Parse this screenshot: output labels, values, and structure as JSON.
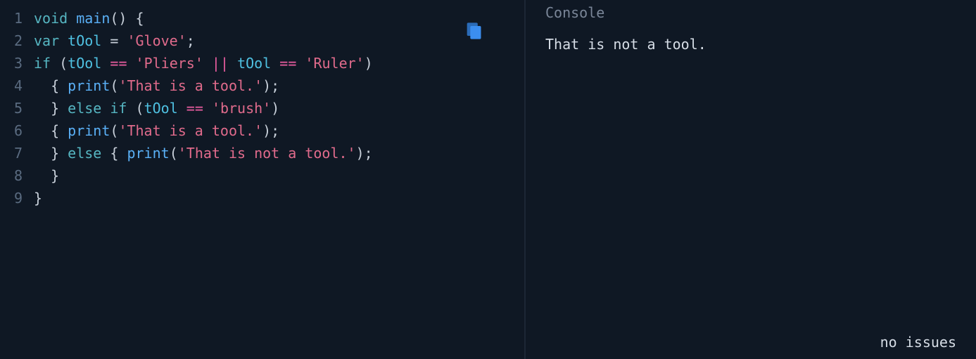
{
  "editor": {
    "line_numbers": [
      "1",
      "2",
      "3",
      "4",
      "5",
      "6",
      "7",
      "8",
      "9"
    ],
    "lines": [
      [
        {
          "cls": "kw",
          "t": "void"
        },
        {
          "cls": "pn",
          "t": " "
        },
        {
          "cls": "fn",
          "t": "main"
        },
        {
          "cls": "pn",
          "t": "() {"
        }
      ],
      [
        {
          "cls": "kw",
          "t": "var"
        },
        {
          "cls": "pn",
          "t": " "
        },
        {
          "cls": "id",
          "t": "tOol"
        },
        {
          "cls": "pn",
          "t": " = "
        },
        {
          "cls": "str",
          "t": "'Glove'"
        },
        {
          "cls": "pn",
          "t": ";"
        }
      ],
      [
        {
          "cls": "kw",
          "t": "if"
        },
        {
          "cls": "pn",
          "t": " ("
        },
        {
          "cls": "id",
          "t": "tOol"
        },
        {
          "cls": "pn",
          "t": " "
        },
        {
          "cls": "op",
          "t": "=="
        },
        {
          "cls": "pn",
          "t": " "
        },
        {
          "cls": "str",
          "t": "'Pliers'"
        },
        {
          "cls": "pn",
          "t": " "
        },
        {
          "cls": "op",
          "t": "||"
        },
        {
          "cls": "pn",
          "t": " "
        },
        {
          "cls": "id",
          "t": "tOol"
        },
        {
          "cls": "pn",
          "t": " "
        },
        {
          "cls": "op",
          "t": "=="
        },
        {
          "cls": "pn",
          "t": " "
        },
        {
          "cls": "str",
          "t": "'Ruler'"
        },
        {
          "cls": "pn",
          "t": ")"
        }
      ],
      [
        {
          "cls": "pn",
          "t": "  { "
        },
        {
          "cls": "fn",
          "t": "print"
        },
        {
          "cls": "pn",
          "t": "("
        },
        {
          "cls": "str",
          "t": "'That is a tool.'"
        },
        {
          "cls": "pn",
          "t": ");"
        }
      ],
      [
        {
          "cls": "pn",
          "t": "  } "
        },
        {
          "cls": "kw",
          "t": "else"
        },
        {
          "cls": "pn",
          "t": " "
        },
        {
          "cls": "kw",
          "t": "if"
        },
        {
          "cls": "pn",
          "t": " ("
        },
        {
          "cls": "id",
          "t": "tOol"
        },
        {
          "cls": "pn",
          "t": " "
        },
        {
          "cls": "op",
          "t": "=="
        },
        {
          "cls": "pn",
          "t": " "
        },
        {
          "cls": "str",
          "t": "'brush'"
        },
        {
          "cls": "pn",
          "t": ")"
        }
      ],
      [
        {
          "cls": "pn",
          "t": "  { "
        },
        {
          "cls": "fn",
          "t": "print"
        },
        {
          "cls": "pn",
          "t": "("
        },
        {
          "cls": "str",
          "t": "'That is a tool.'"
        },
        {
          "cls": "pn",
          "t": ");"
        }
      ],
      [
        {
          "cls": "pn",
          "t": "  } "
        },
        {
          "cls": "kw",
          "t": "else"
        },
        {
          "cls": "pn",
          "t": " { "
        },
        {
          "cls": "fn",
          "t": "print"
        },
        {
          "cls": "pn",
          "t": "("
        },
        {
          "cls": "str",
          "t": "'That is not a tool.'"
        },
        {
          "cls": "pn",
          "t": ");"
        }
      ],
      [
        {
          "cls": "pn",
          "t": "  }"
        }
      ],
      [
        {
          "cls": "pn",
          "t": "}"
        }
      ]
    ]
  },
  "console": {
    "title": "Console",
    "output": "That is not a tool."
  },
  "status": "no issues"
}
